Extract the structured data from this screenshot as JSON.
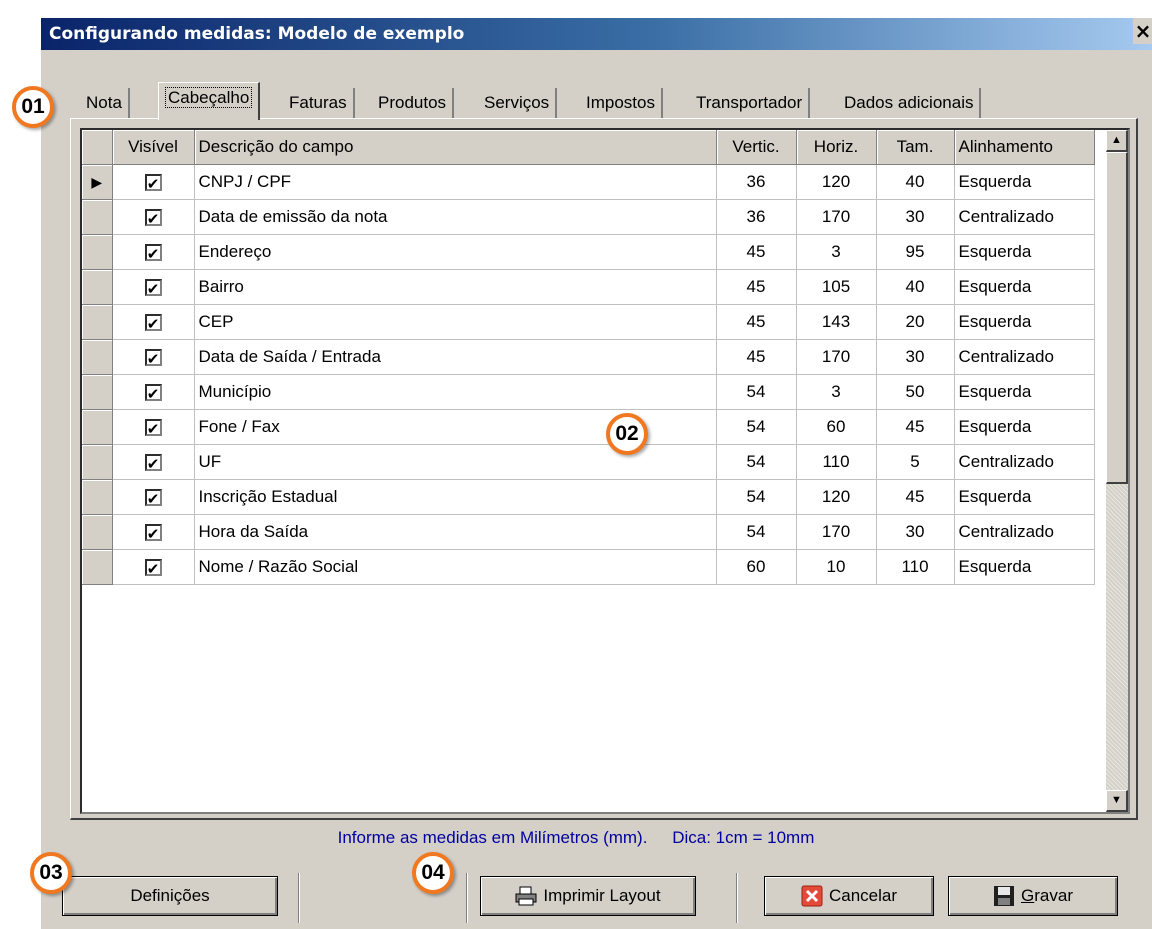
{
  "window": {
    "title": "Configurando medidas: Modelo de exemplo",
    "close": "×"
  },
  "tabs": [
    {
      "label": "Nota"
    },
    {
      "label": "Cabeçalho"
    },
    {
      "label": "Faturas"
    },
    {
      "label": "Produtos"
    },
    {
      "label": "Serviços"
    },
    {
      "label": "Impostos"
    },
    {
      "label": "Transportador"
    },
    {
      "label": "Dados adicionais"
    }
  ],
  "table": {
    "columns": [
      "Visível",
      "Descrição do campo",
      "Vertic.",
      "Horiz.",
      "Tam.",
      "Alinhamento"
    ],
    "rows": [
      {
        "visible": "✔",
        "desc": "CNPJ / CPF",
        "vert": "36",
        "horiz": "120",
        "tam": "40",
        "align": "Esquerda"
      },
      {
        "visible": "✔",
        "desc": "Data de emissão da nota",
        "vert": "36",
        "horiz": "170",
        "tam": "30",
        "align": "Centralizado"
      },
      {
        "visible": "✔",
        "desc": "Endereço",
        "vert": "45",
        "horiz": "3",
        "tam": "95",
        "align": "Esquerda"
      },
      {
        "visible": "✔",
        "desc": "Bairro",
        "vert": "45",
        "horiz": "105",
        "tam": "40",
        "align": "Esquerda"
      },
      {
        "visible": "✔",
        "desc": "CEP",
        "vert": "45",
        "horiz": "143",
        "tam": "20",
        "align": "Esquerda"
      },
      {
        "visible": "✔",
        "desc": "Data de Saída / Entrada",
        "vert": "45",
        "horiz": "170",
        "tam": "30",
        "align": "Centralizado"
      },
      {
        "visible": "✔",
        "desc": "Município",
        "vert": "54",
        "horiz": "3",
        "tam": "50",
        "align": "Esquerda"
      },
      {
        "visible": "✔",
        "desc": "Fone / Fax",
        "vert": "54",
        "horiz": "60",
        "tam": "45",
        "align": "Esquerda"
      },
      {
        "visible": "✔",
        "desc": "UF",
        "vert": "54",
        "horiz": "110",
        "tam": "5",
        "align": "Centralizado"
      },
      {
        "visible": "✔",
        "desc": "Inscrição Estadual",
        "vert": "54",
        "horiz": "120",
        "tam": "45",
        "align": "Esquerda"
      },
      {
        "visible": "✔",
        "desc": "Hora da Saída",
        "vert": "54",
        "horiz": "170",
        "tam": "30",
        "align": "Centralizado"
      },
      {
        "visible": "✔",
        "desc": "Nome / Razão Social",
        "vert": "60",
        "horiz": "10",
        "tam": "110",
        "align": "Esquerda"
      }
    ],
    "current_row_marker": "▶"
  },
  "scrollbar": {
    "up": "▲",
    "down": "▼"
  },
  "hint": {
    "units": "Informe as medidas em Milímetros (mm).",
    "tip": "Dica: 1cm = 10mm"
  },
  "buttons": {
    "definicoes": "Definições",
    "imprimir": "Imprimir Layout",
    "cancelar": "Cancelar",
    "gravar_prefix": "G",
    "gravar_rest": "ravar"
  },
  "icons": {
    "printer": "printer-icon",
    "cancel": "cancel-icon",
    "save": "save-icon"
  },
  "callouts": [
    "01",
    "02",
    "03",
    "04"
  ],
  "colors": {
    "callout_border": "#f07820",
    "hint_text": "#0000a0",
    "title_bar": "#0a246a"
  }
}
